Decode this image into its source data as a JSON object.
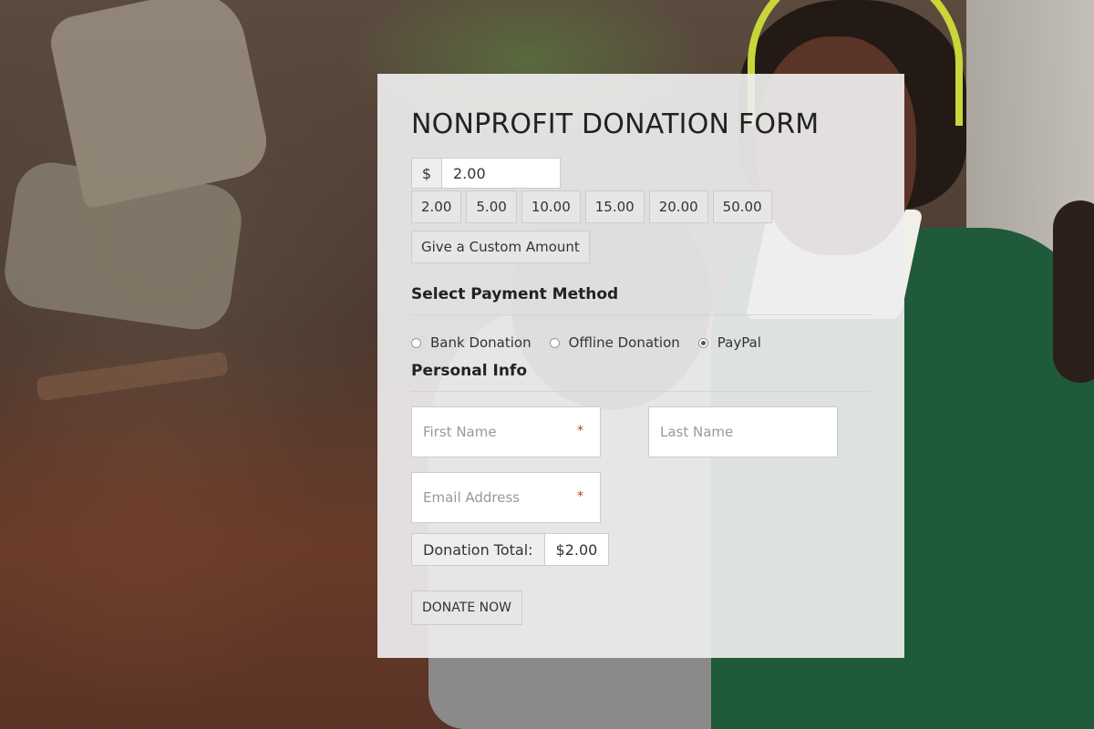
{
  "form": {
    "title": "NONPROFIT DONATION FORM",
    "amount": {
      "currency_symbol": "$",
      "value": "2.00"
    },
    "presets": [
      "2.00",
      "5.00",
      "10.00",
      "15.00",
      "20.00",
      "50.00"
    ],
    "custom_amount_label": "Give a Custom Amount",
    "payment_section_title": "Select Payment Method",
    "payment_methods": [
      {
        "label": "Bank Donation",
        "selected": false
      },
      {
        "label": "Offline Donation",
        "selected": false
      },
      {
        "label": "PayPal",
        "selected": true
      }
    ],
    "personal_section_title": "Personal Info",
    "fields": {
      "first_name_placeholder": "First Name",
      "last_name_placeholder": "Last Name",
      "email_placeholder": "Email Address",
      "required_marker": "*"
    },
    "total": {
      "label": "Donation Total:",
      "value": "$2.00"
    },
    "donate_button_label": "DONATE NOW"
  },
  "colors": {
    "card_background": "#eeeeee",
    "required": "#c0392b"
  }
}
